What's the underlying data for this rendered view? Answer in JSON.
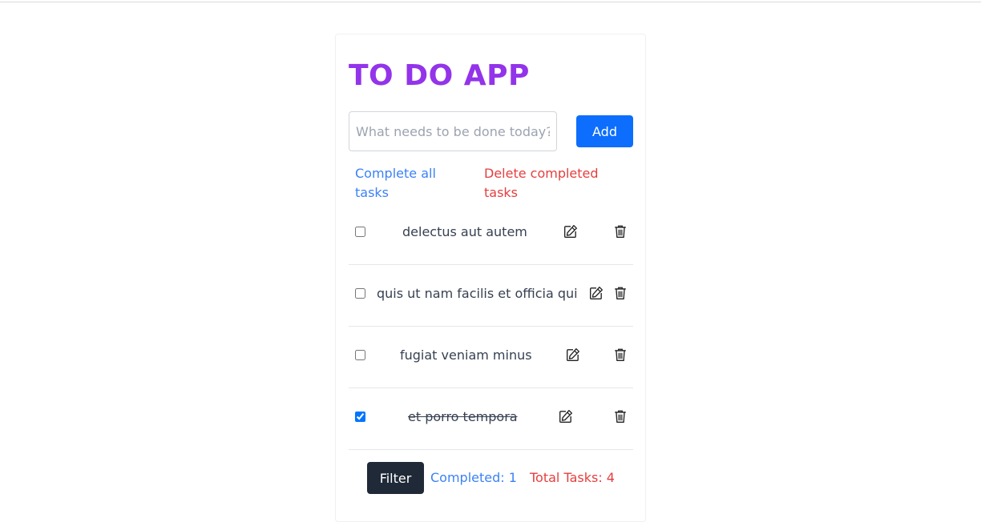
{
  "app": {
    "title": "TO DO APP"
  },
  "input": {
    "placeholder": "What needs to be done today?",
    "value": ""
  },
  "buttons": {
    "add_label": "Add",
    "filter_label": "Filter"
  },
  "actions": {
    "complete_all": "Complete all tasks",
    "delete_completed": "Delete completed tasks"
  },
  "tasks": [
    {
      "text": "delectus aut autem",
      "completed": false
    },
    {
      "text": "quis ut nam facilis et officia qui",
      "completed": false
    },
    {
      "text": "fugiat veniam minus",
      "completed": false
    },
    {
      "text": "et porro tempora",
      "completed": true
    }
  ],
  "stats": {
    "completed": "Completed: 1",
    "total": "Total Tasks: 4"
  },
  "colors": {
    "title": "#9333ea",
    "primary": "#0d6efd",
    "link_blue": "#3b82f6",
    "danger": "#e53e3e",
    "dark_button": "#1f2937"
  },
  "icons": {
    "edit": "edit-icon",
    "delete": "trash-icon"
  }
}
